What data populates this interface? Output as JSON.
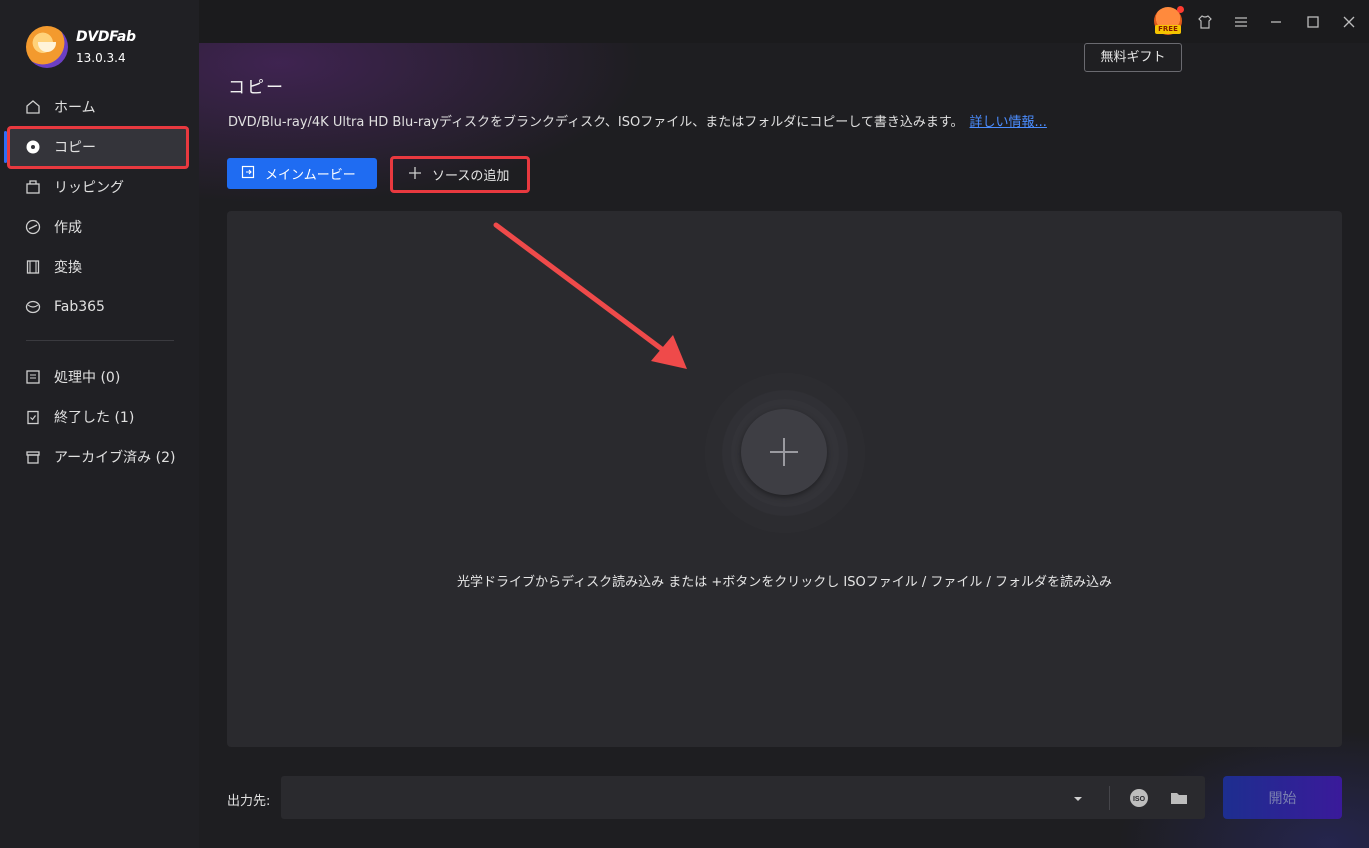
{
  "app": {
    "brand": "DVDFab",
    "version": "13.0.3.4"
  },
  "sidebar": {
    "items": [
      {
        "label": "ホーム",
        "icon": "home-icon"
      },
      {
        "label": "コピー",
        "icon": "disc-icon"
      },
      {
        "label": "リッピング",
        "icon": "ripping-icon"
      },
      {
        "label": "作成",
        "icon": "creator-icon"
      },
      {
        "label": "変換",
        "icon": "film-icon"
      },
      {
        "label": "Fab365",
        "icon": "fab365-icon"
      }
    ],
    "tasks": [
      {
        "label": "処理中 (0)",
        "icon": "queue-icon"
      },
      {
        "label": "終了した (1)",
        "icon": "clipboard-check-icon"
      },
      {
        "label": "アーカイブ済み (2)",
        "icon": "archive-icon"
      }
    ]
  },
  "titlebar": {
    "free_badge": "FREE",
    "tooltip": "無料ギフト"
  },
  "main": {
    "title": "コピー",
    "description": "DVD/Blu-ray/4K Ultra HD Blu-rayディスクをブランクディスク、ISOファイル、またはフォルダにコピーして書き込みます。",
    "more_link": "詳しい情報...",
    "mode_button": "メインムービー",
    "add_source_button": "ソースの追加",
    "drop_hint": "光学ドライブからディスク読み込み または +ボタンをクリックし ISOファイル / ファイル / フォルダを読み込み",
    "output_label": "出力先:",
    "output_value": "",
    "iso_label": "ISO",
    "start_button": "開始"
  },
  "colors": {
    "accent": "#1f6cf2",
    "highlight": "#e8393f",
    "link": "#4b8dff"
  }
}
